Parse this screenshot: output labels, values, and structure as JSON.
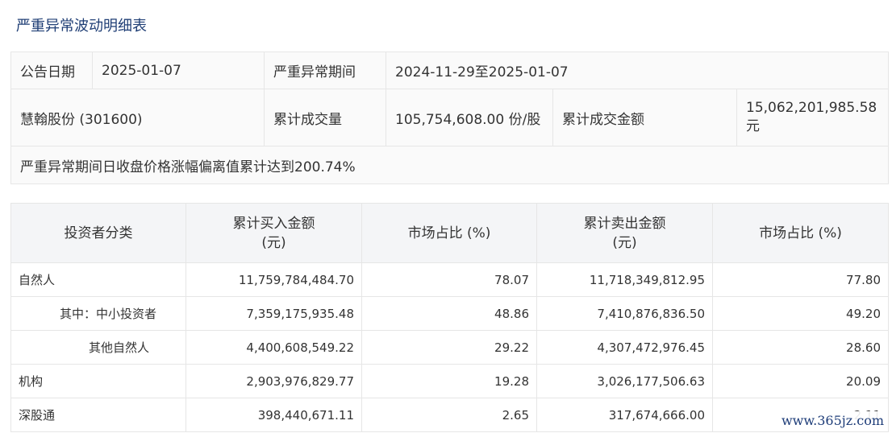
{
  "page_title": "严重异常波动明细表",
  "summary": {
    "announce_date_label": "公告日期",
    "announce_date": "2025-01-07",
    "period_label": "严重异常期间",
    "period": "2024-11-29至2025-01-07",
    "stock": "慧翰股份 (301600)",
    "volume_label": "累计成交量",
    "volume": "105,754,608.00 份/股",
    "amount_label": "累计成交金额",
    "amount": "15,062,201,985.58 元",
    "note": "严重异常期间日收盘价格涨幅偏离值累计达到200.74%"
  },
  "detail": {
    "headers": [
      "投资者分类",
      "累计买入金额\n(元)",
      "市场占比 (%)",
      "累计卖出金额\n(元)",
      "市场占比 (%)"
    ],
    "rows": [
      {
        "name": "自然人",
        "buy": "11,759,784,484.70",
        "buy_pct": "78.07",
        "sell": "11,718,349,812.95",
        "sell_pct": "77.80"
      },
      {
        "name": "其中：中小投资者",
        "buy": "7,359,175,935.48",
        "buy_pct": "48.86",
        "sell": "7,410,876,836.50",
        "sell_pct": "49.20"
      },
      {
        "name": "其他自然人",
        "buy": "4,400,608,549.22",
        "buy_pct": "29.22",
        "sell": "4,307,472,976.45",
        "sell_pct": "28.60"
      },
      {
        "name": "机构",
        "buy": "2,903,976,829.77",
        "buy_pct": "19.28",
        "sell": "3,026,177,506.63",
        "sell_pct": "20.09"
      },
      {
        "name": "深股通",
        "buy": "398,440,671.11",
        "buy_pct": "2.65",
        "sell": "317,674,666.00",
        "sell_pct": "2.11"
      }
    ]
  },
  "watermark": "www.365jz.com"
}
